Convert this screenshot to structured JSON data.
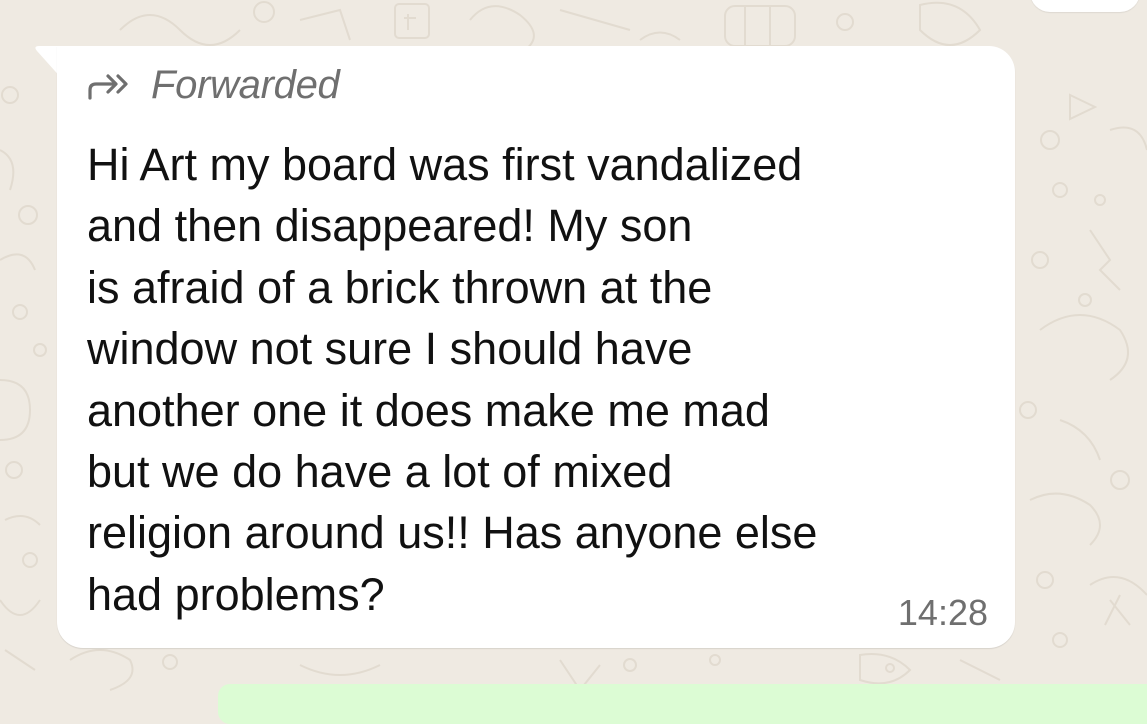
{
  "colors": {
    "wallpaper": "#efeae2",
    "bubble": "#ffffff",
    "text": "#111111",
    "meta": "#6f6f6f",
    "outgoing_bubble": "#dcfcd4"
  },
  "message": {
    "forwarded_icon": "forward-double-arrow-icon",
    "forwarded_label": "Forwarded",
    "body": "Hi Art my board was first vandalized\nand then disappeared! My son\nis afraid of a brick thrown at the\nwindow not sure I should have\nanother one it does make me mad\nbut we do have a lot of mixed\nreligion around us!! Has anyone else\nhad problems?",
    "time": "14:28"
  }
}
